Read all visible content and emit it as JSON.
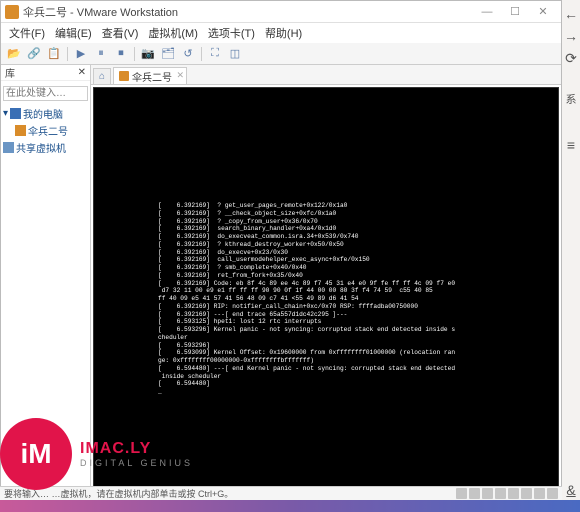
{
  "window": {
    "title": "伞兵二号 - VMware Workstation",
    "btn_min": "—",
    "btn_max": "☐",
    "btn_close": "✕"
  },
  "menu": {
    "file": "文件(F)",
    "edit": "编辑(E)",
    "view": "查看(V)",
    "vm": "虚拟机(M)",
    "tabs": "选项卡(T)",
    "help": "帮助(H)"
  },
  "sidebar": {
    "header": "库",
    "close": "✕",
    "search_placeholder": "在此处键入…",
    "items": [
      {
        "label": "我的电脑"
      },
      {
        "label": "伞兵二号"
      },
      {
        "label": "共享虚拟机"
      }
    ]
  },
  "tabs": {
    "home": "⌂",
    "active": {
      "label": "伞兵二号",
      "close": "✕"
    }
  },
  "terminal": {
    "text": "[    6.392169]  ? get_user_pages_remote+0x122/0x1a0\n[    6.392169]  ? __check_object_size+0xfc/0x1a0\n[    6.392169]  ? _copy_from_user+0x36/0x70\n[    6.392169]  search_binary_handler+0xa4/0x1d0\n[    6.392169]  do_execveat_common.isra.34+0x539/0x740\n[    6.392169]  ? kthread_destroy_worker+0x50/0x50\n[    6.392169]  do_execve+0x23/0x30\n[    6.392169]  call_usermodehelper_exec_async+0xfe/0x150\n[    6.392169]  ? smb_complete+0x40/0x40\n[    6.392169]  ret_from_fork+0x35/0x40\n[    6.392169] Code: eb 8f 4c 89 ee 4c 89 f7 45 31 e4 e0 9f fe ff ff 4c 09 f7 e0\n d7 32 11 00 e9 e1 ff ff ff 90 90 0f 1f 44 00 00 80 3f f4 74 59  c55 40 85\nff 40 09 e5 41 57 41 56 48 09 c7 41 <55 49 89 d6 41 54\n[    6.392169] RIP: notifier_call_chain+0xc/0x70 RSP: ffffadba00750000\n[    6.392169] ---[ end trace 65a557d1dc42c295 ]---\n[    6.593125] hpet1: lost 12 rtc interrupts\n[    6.593296] Kernel panic - not syncing: corrupted stack end detected inside s\ncheduler\n[    6.593296]\n[    6.593099] Kernel Offset: 0x19600000 from 0xffffffff01000000 (relocation ran\nge: 0xffffffff00000000-0xffffffffbfffffff)\n[    6.594480] ---[ end Kernel panic - not syncing: corrupted stack end detected\n inside scheduler\n[    6.594480]\n_"
  },
  "status": {
    "text": "要将输入… …虚拟机，请在虚拟机内部单击或按 Ctrl+G。"
  },
  "watermark": {
    "initials": "iM",
    "line1": "IMAC.LY",
    "line2": "DIGITAL GENIUS"
  },
  "rightedge": {
    "back": "←",
    "fwd": "→",
    "refresh": "⟳",
    "xi": "系",
    "menu": "≡",
    "bottom": "&"
  }
}
